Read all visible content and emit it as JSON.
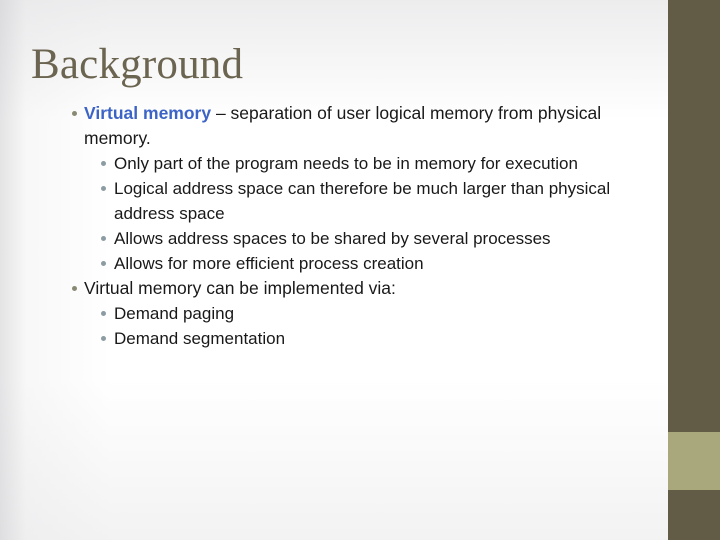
{
  "slide": {
    "title": "Background",
    "theme": {
      "title_color": "#6B6450",
      "band_color": "#625B46",
      "band_accent_color": "#A9A87C",
      "keyword_color": "#3C64C6",
      "body_color": "#191919",
      "bullet_level1_color": "#8A8A74",
      "bullet_level2_color": "#8D9BA3",
      "background_color": "#FFFFFF"
    },
    "bullets": [
      {
        "level": 1,
        "keyword": "Virtual memory",
        "text": " – separation of user logical memory from physical memory.",
        "children": [
          {
            "level": 2,
            "text": "Only part of the program needs to be in memory for execution"
          },
          {
            "level": 2,
            "text": "Logical address space can therefore be much larger than physical address space"
          },
          {
            "level": 2,
            "text": "Allows address spaces to be shared by several processes"
          },
          {
            "level": 2,
            "text": "Allows for more efficient process creation"
          }
        ]
      },
      {
        "level": 1,
        "keyword": "",
        "text": "Virtual memory can be implemented via:",
        "children": [
          {
            "level": 2,
            "text": "Demand paging"
          },
          {
            "level": 2,
            "text": "Demand segmentation"
          }
        ]
      }
    ]
  }
}
